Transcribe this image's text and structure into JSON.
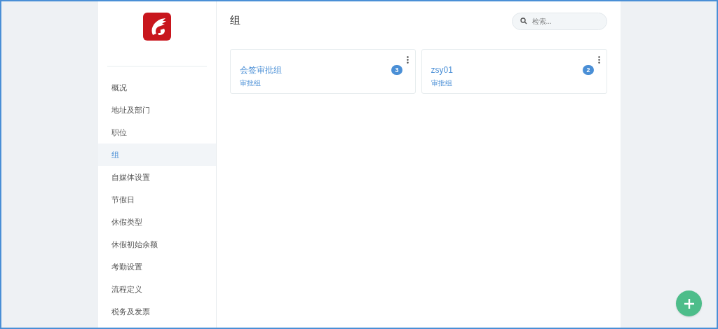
{
  "sidebar": {
    "items": [
      {
        "label": "概况",
        "selected": false
      },
      {
        "label": "地址及部门",
        "selected": false
      },
      {
        "label": "职位",
        "selected": false
      },
      {
        "label": "组",
        "selected": true
      },
      {
        "label": "自媒体设置",
        "selected": false
      },
      {
        "label": "节假日",
        "selected": false
      },
      {
        "label": "休假类型",
        "selected": false
      },
      {
        "label": "休假初始余额",
        "selected": false
      },
      {
        "label": "考勤设置",
        "selected": false
      },
      {
        "label": "流程定义",
        "selected": false
      },
      {
        "label": "税务及发票",
        "selected": false
      }
    ]
  },
  "main": {
    "title": "组",
    "search": {
      "placeholder": "检索..."
    },
    "cards": [
      {
        "name": "会签审批组",
        "type": "审批组",
        "count": "3"
      },
      {
        "name": "zsy01",
        "type": "审批组",
        "count": "2"
      }
    ]
  }
}
